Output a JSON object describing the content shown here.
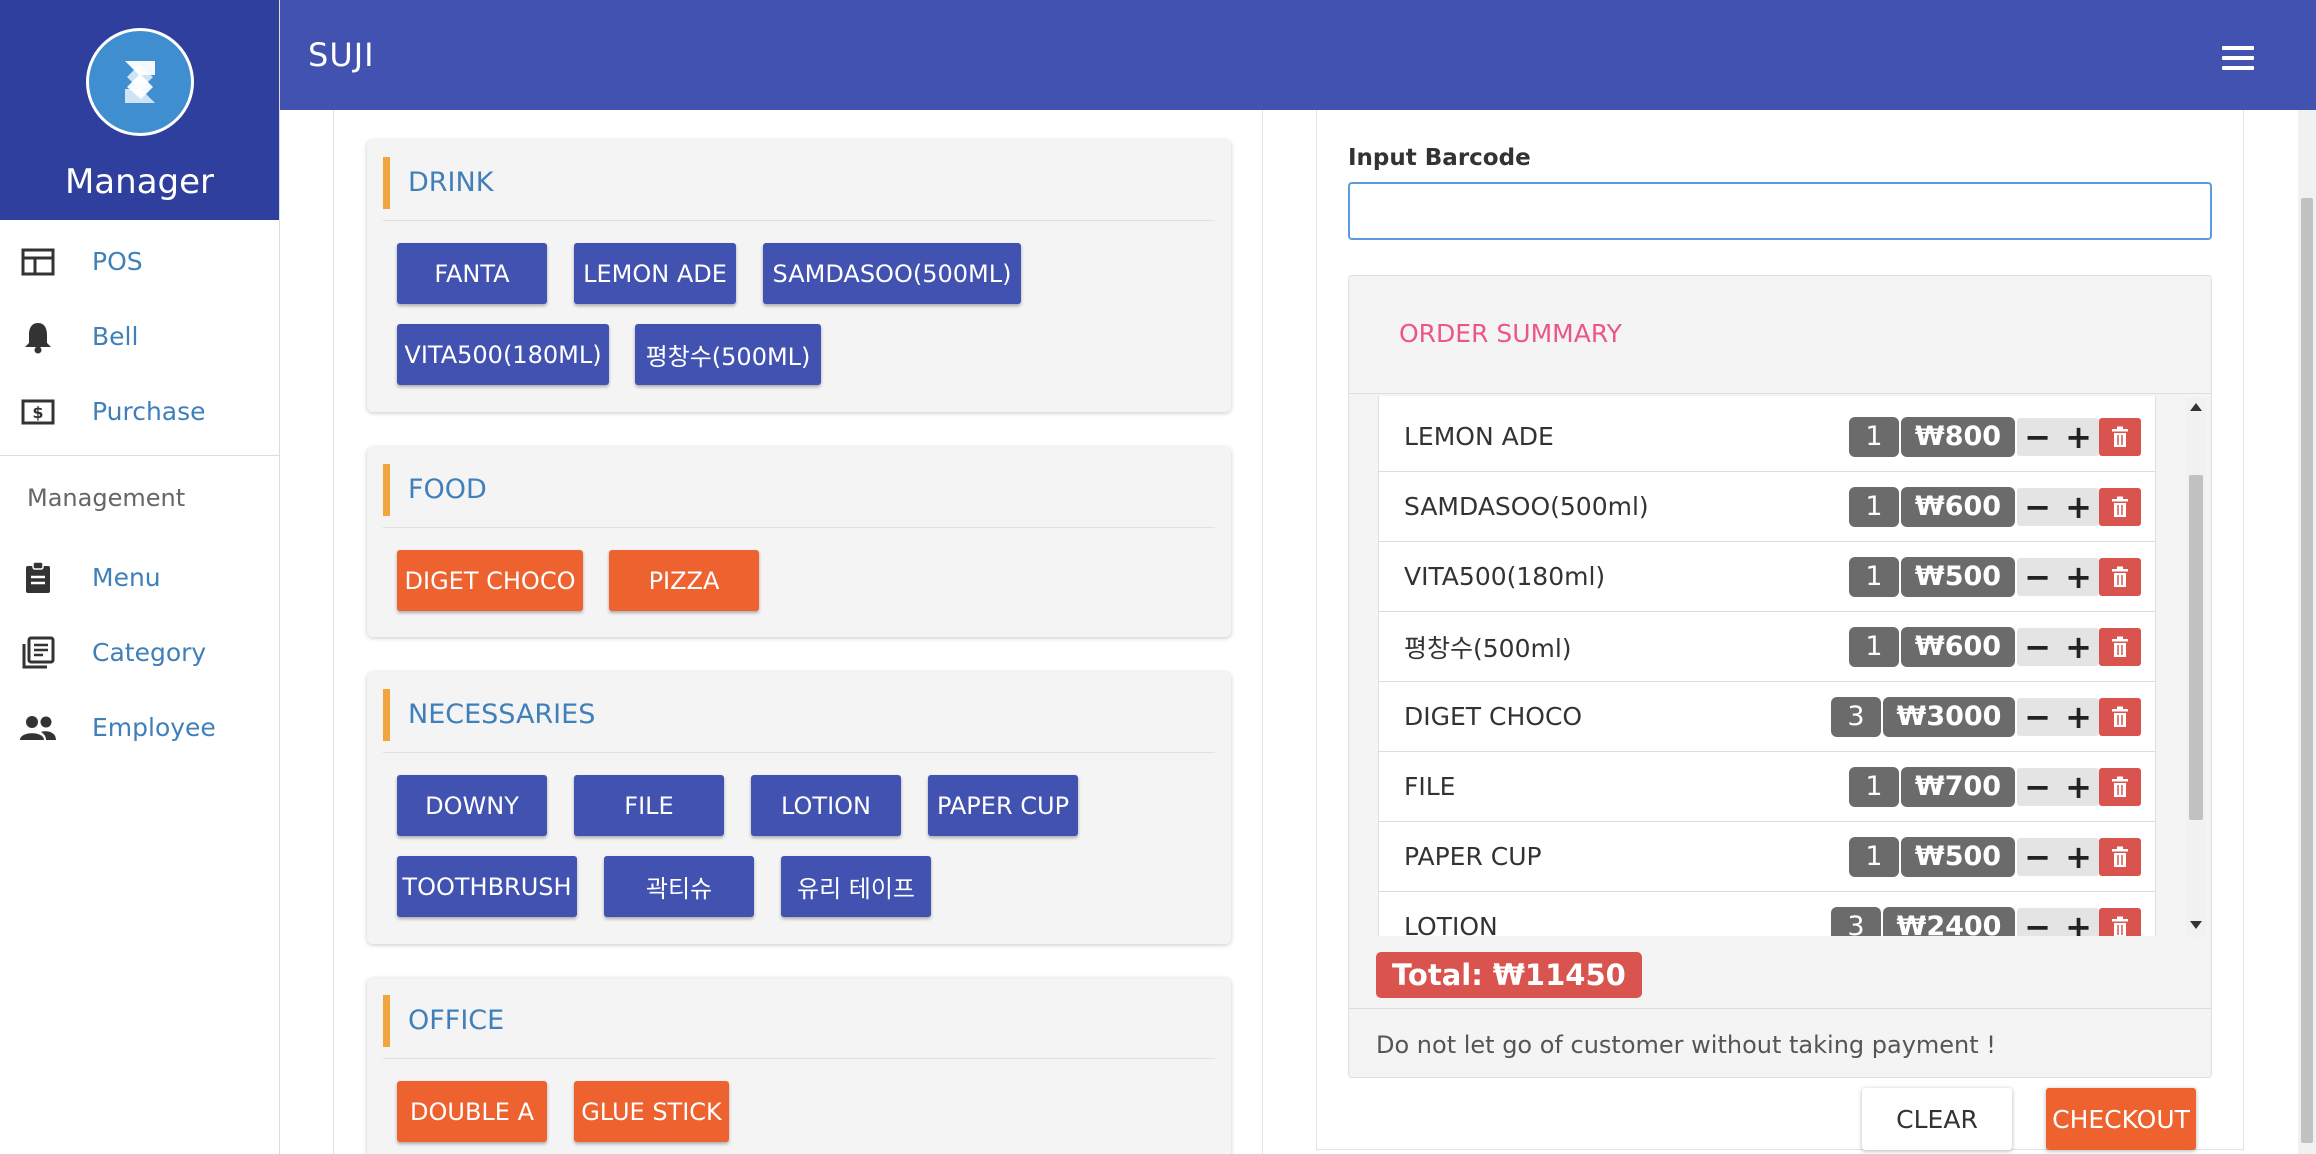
{
  "sidebar": {
    "brand": "Manager",
    "items": [
      {
        "label": "POS",
        "icon": "pos-icon"
      },
      {
        "label": "Bell",
        "icon": "bell-icon"
      },
      {
        "label": "Purchase",
        "icon": "purchase-icon"
      }
    ],
    "section_label": "Management",
    "management_items": [
      {
        "label": "Menu",
        "icon": "clipboard-icon"
      },
      {
        "label": "Category",
        "icon": "category-icon"
      },
      {
        "label": "Employee",
        "icon": "people-icon"
      }
    ]
  },
  "header": {
    "title": "SUJI"
  },
  "categories": [
    {
      "title": "DRINK",
      "buttons": [
        "FANTA",
        "LEMON ADE",
        "SAMDASOO(500ML)",
        "VITA500(180ML)",
        "평창수(500ML)"
      ]
    },
    {
      "title": "FOOD",
      "buttons": [
        "DIGET CHOCO",
        "PIZZA"
      ]
    },
    {
      "title": "NECESSARIES",
      "buttons": [
        "DOWNY",
        "FILE",
        "LOTION",
        "PAPER CUP",
        "TOOTHBRUSH",
        "곽티슈",
        "유리 테이프"
      ]
    },
    {
      "title": "OFFICE",
      "buttons": [
        "DOUBLE A",
        "GLUE STICK"
      ]
    }
  ],
  "barcode": {
    "label": "Input Barcode",
    "value": "",
    "placeholder": ""
  },
  "order_summary": {
    "title": "ORDER SUMMARY",
    "items": [
      {
        "name": "LEMON ADE",
        "qty": "1",
        "price": "₩800"
      },
      {
        "name": "SAMDASOO(500ml)",
        "qty": "1",
        "price": "₩600"
      },
      {
        "name": "VITA500(180ml)",
        "qty": "1",
        "price": "₩500"
      },
      {
        "name": "평창수(500ml)",
        "qty": "1",
        "price": "₩600"
      },
      {
        "name": "DIGET CHOCO",
        "qty": "3",
        "price": "₩3000"
      },
      {
        "name": "FILE",
        "qty": "1",
        "price": "₩700"
      },
      {
        "name": "PAPER CUP",
        "qty": "1",
        "price": "₩500"
      },
      {
        "name": "LOTION",
        "qty": "3",
        "price": "₩2400"
      }
    ],
    "minus_label": "−",
    "plus_label": "+",
    "total": "Total: ₩11450",
    "note": "Do not let go of customer without taking payment !"
  },
  "actions": {
    "clear": "CLEAR",
    "checkout": "CHECKOUT"
  },
  "colors": {
    "header": "#4152b1",
    "sidebar_head": "#2f3f9e",
    "drink_button": "#4152b1",
    "food_button": "#ee6230",
    "accent_bar": "#f0a63c",
    "summary_title": "#ec5686",
    "total_badge": "#d9534f"
  }
}
